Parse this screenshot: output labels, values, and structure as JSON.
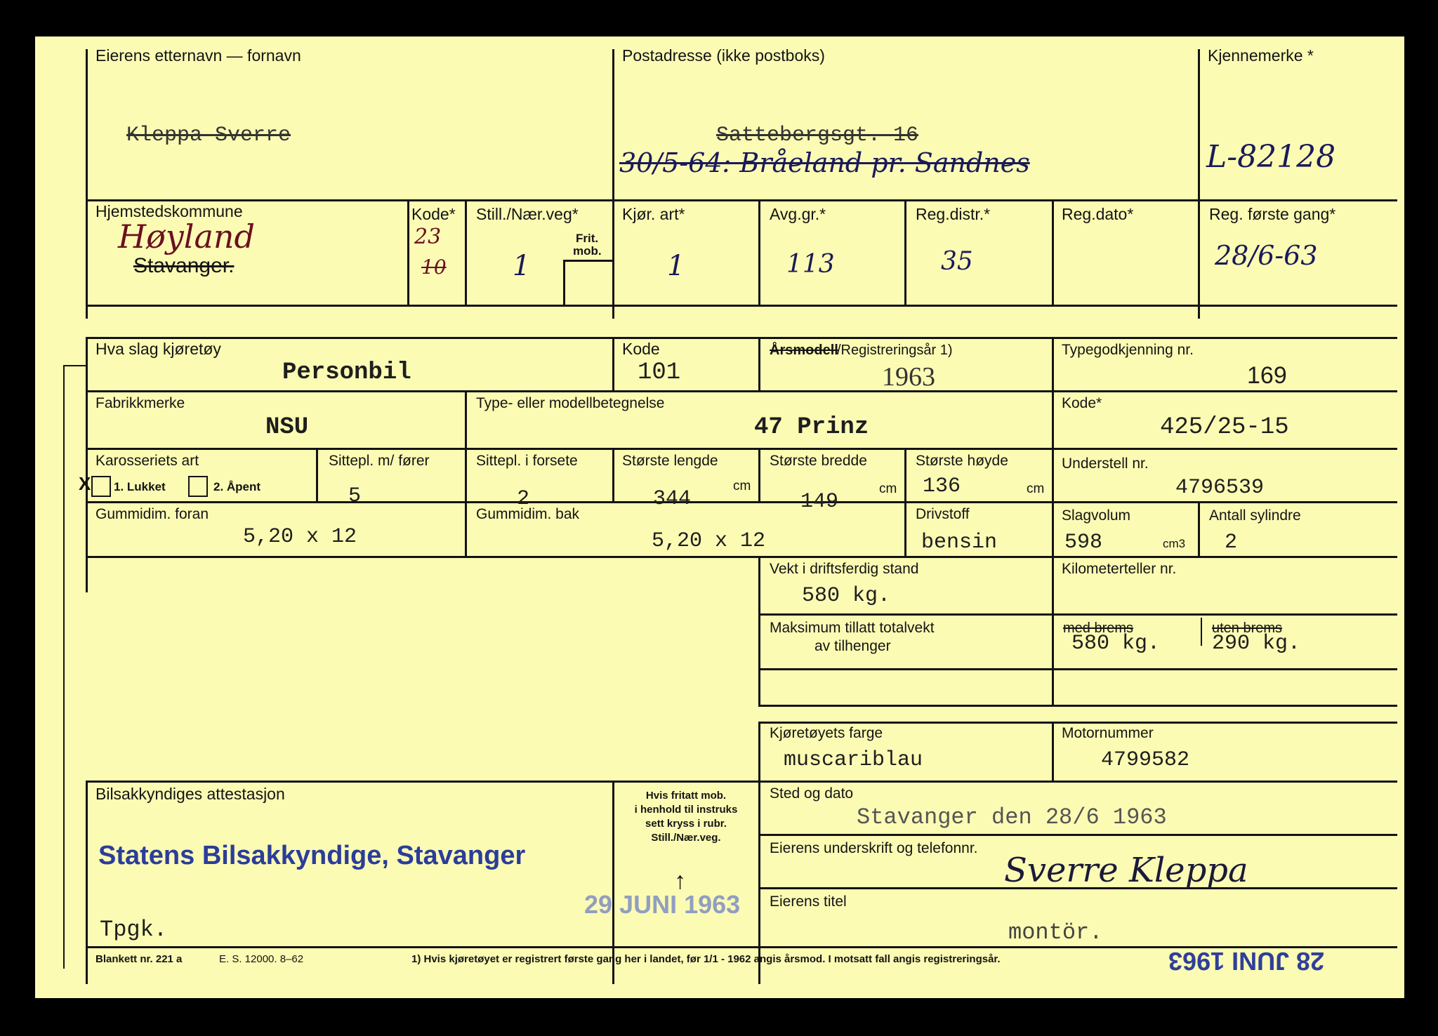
{
  "owner": {
    "label": "Eierens etternavn — fornavn",
    "value_struck": "Kleppa Sverre"
  },
  "address": {
    "label": "Postadresse (ikke postboks)",
    "value_struck": "Sattebergsgt. 16",
    "value_new": "30/5-64: Bråeland pr. Sandnes"
  },
  "plate": {
    "label": "Kjennemerke *",
    "value": "L-82128"
  },
  "municipality": {
    "label": "Hjemstedskommune",
    "value_new": "Høyland",
    "value_struck": "Stavanger."
  },
  "kode1": {
    "label": "Kode*",
    "value_new": "23",
    "value_struck": "10"
  },
  "still": {
    "label": "Still./Nær.veg*",
    "sub1": "Frit.",
    "sub2": "mob.",
    "value": "1"
  },
  "kjor": {
    "label": "Kjør. art*",
    "value": "1"
  },
  "avg": {
    "label": "Avg.gr.*",
    "value": "113"
  },
  "regdistr": {
    "label": "Reg.distr.*",
    "value": "35"
  },
  "regdato": {
    "label": "Reg.dato*"
  },
  "regforste": {
    "label": "Reg. første gang*",
    "value": "28/6-63"
  },
  "vehicle": {
    "kind_label": "Hva slag kjøretøy",
    "kind": "Personbil",
    "kode_label": "Kode",
    "kode": "101",
    "year_label_struck": "Årsmodell",
    "year_label": "/Registreringsår 1)",
    "year": "1963",
    "type_appr_label": "Typegodkjenning nr.",
    "type_appr": "169",
    "make_label": "Fabrikkmerke",
    "make": "NSU",
    "model_label": "Type- eller modellbetegnelse",
    "model": "47 Prinz",
    "kode2_label": "Kode*",
    "kode2": "425/25-15",
    "body_label": "Karosseriets art",
    "body_opt1": "1. Lukket",
    "body_opt2": "2. Åpent",
    "body_mark": "X",
    "seats_label": "Sittepl. m/ fører",
    "seats": "5",
    "front_seats_label": "Sittepl. i forsete",
    "front_seats": "2",
    "length_label": "Største lengde",
    "length": "344",
    "width_label": "Største bredde",
    "width": "149",
    "height_label": "Største høyde",
    "height": "136",
    "unit_cm": "cm",
    "chassis_label": "Understell nr.",
    "chassis": "4796539",
    "tyre_front_label": "Gummidim. foran",
    "tyre_front": "5,20 x 12",
    "tyre_rear_label": "Gummidim. bak",
    "tyre_rear": "5,20 x 12",
    "fuel_label": "Drivstoff",
    "fuel": "bensin",
    "volume_label": "Slagvolum",
    "volume": "598",
    "volume_unit": "cm3",
    "cyl_label": "Antall sylindre",
    "cyl": "2",
    "weight_label": "Vekt i driftsferdig stand",
    "weight": "580 kg.",
    "km_label": "Kilometerteller nr.",
    "trailer_label1": "Maksimum tillatt totalvekt",
    "trailer_label2": "av tilhenger",
    "with_brake_label": "med brems",
    "with_brake": "580 kg.",
    "without_brake_label": "uten brems",
    "without_brake": "290 kg.",
    "color_label": "Kjøretøyets farge",
    "color": "muscariblau",
    "engine_label": "Motornummer",
    "engine": "4799582"
  },
  "attest": {
    "label": "Bilsakkyndiges attestasjon",
    "stamp": "Statens Bilsakkyndige, Stavanger",
    "tpgk": "Tpgk.",
    "note1": "Hvis fritatt mob.",
    "note2": "i henhold til instruks",
    "note3": "sett kryss i rubr.",
    "note4": "Still./Nær.veg.",
    "arrow": "↑",
    "date_stamp": "29 JUNI 1963"
  },
  "place": {
    "label": "Sted og dato",
    "value": "Stavanger den 28/6 1963"
  },
  "signature": {
    "label": "Eierens underskrift og telefonnr.",
    "value": "Sverre Kleppa"
  },
  "title": {
    "label": "Eierens titel",
    "value": "montör."
  },
  "footer": {
    "form": "Blankett nr. 221 a",
    "print": "E. S. 12000. 8–62",
    "note": "1) Hvis kjøretøyet er registrert første gang her i landet, før 1/1 - 1962 angis årsmod. I motsatt fall angis registreringsår.",
    "stamp": "28 JUNI 1963"
  }
}
